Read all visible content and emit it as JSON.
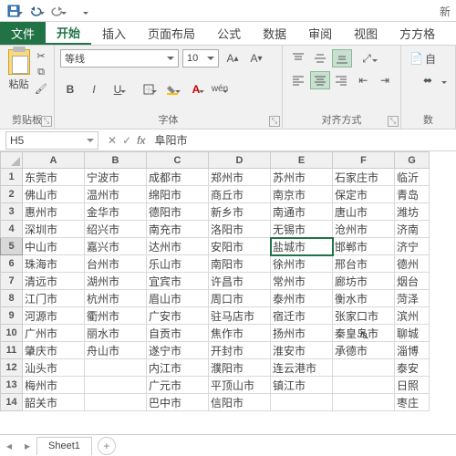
{
  "qat": {
    "title_right": "新"
  },
  "tabs": {
    "file": "文件",
    "home": "开始",
    "insert": "插入",
    "layout": "页面布局",
    "formulas": "公式",
    "data": "数据",
    "review": "审阅",
    "view": "视图",
    "sq": "方方格"
  },
  "ribbon": {
    "clipboard": {
      "paste": "粘贴",
      "label": "剪贴板"
    },
    "font": {
      "name": "等线",
      "size": "10",
      "label": "字体",
      "bold": "B",
      "italic": "I",
      "underline": "U",
      "wen": "wén"
    },
    "align": {
      "label": "对齐方式",
      "wrap": "自"
    },
    "number": {
      "label": "数"
    }
  },
  "namebox": "H5",
  "formula": "阜阳市",
  "active_cell": {
    "row": 5,
    "col": 4
  },
  "columns": [
    "A",
    "B",
    "C",
    "D",
    "E",
    "F",
    "G"
  ],
  "rows": [
    [
      "东莞市",
      "宁波市",
      "成都市",
      "郑州市",
      "苏州市",
      "石家庄市",
      "临沂"
    ],
    [
      "佛山市",
      "温州市",
      "绵阳市",
      "商丘市",
      "南京市",
      "保定市",
      "青岛"
    ],
    [
      "惠州市",
      "金华市",
      "德阳市",
      "新乡市",
      "南通市",
      "唐山市",
      "潍坊"
    ],
    [
      "深圳市",
      "绍兴市",
      "南充市",
      "洛阳市",
      "无锡市",
      "沧州市",
      "济南"
    ],
    [
      "中山市",
      "嘉兴市",
      "达州市",
      "安阳市",
      "盐城市",
      "邯郸市",
      "济宁"
    ],
    [
      "珠海市",
      "台州市",
      "乐山市",
      "南阳市",
      "徐州市",
      "邢台市",
      "德州"
    ],
    [
      "清远市",
      "湖州市",
      "宜宾市",
      "许昌市",
      "常州市",
      "廊坊市",
      "烟台"
    ],
    [
      "江门市",
      "杭州市",
      "眉山市",
      "周口市",
      "泰州市",
      "衡水市",
      "菏泽"
    ],
    [
      "河源市",
      "衢州市",
      "广安市",
      "驻马店市",
      "宿迁市",
      "张家口市",
      "滨州"
    ],
    [
      "广州市",
      "丽水市",
      "自贡市",
      "焦作市",
      "扬州市",
      "秦皇岛市",
      "聊城"
    ],
    [
      "肇庆市",
      "舟山市",
      "遂宁市",
      "开封市",
      "淮安市",
      "承德市",
      "淄博"
    ],
    [
      "汕头市",
      "",
      "内江市",
      "濮阳市",
      "连云港市",
      "",
      "泰安"
    ],
    [
      "梅州市",
      "",
      "广元市",
      "平顶山市",
      "镇江市",
      "",
      "日照"
    ],
    [
      "韶关市",
      "",
      "巴中市",
      "信阳市",
      "",
      "",
      "枣庄"
    ]
  ],
  "sheet": {
    "name": "Sheet1"
  }
}
